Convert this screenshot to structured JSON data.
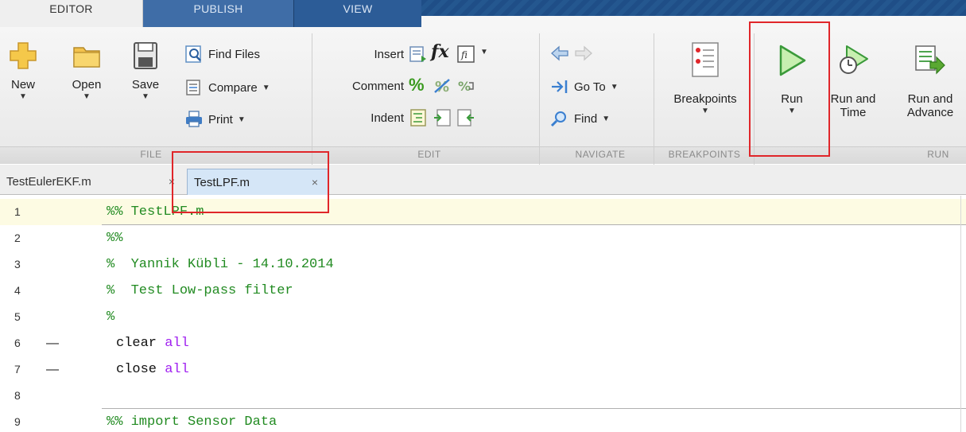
{
  "tabs": {
    "editor": "EDITOR",
    "publish": "PUBLISH",
    "view": "VIEW"
  },
  "file_group": {
    "new": "New",
    "open": "Open",
    "save": "Save",
    "find_files": "Find Files",
    "compare": "Compare",
    "print": "Print",
    "label": "FILE"
  },
  "edit_group": {
    "insert": "Insert",
    "comment": "Comment",
    "indent": "Indent",
    "fx": "fx",
    "label": "EDIT"
  },
  "navigate_group": {
    "go_to": "Go To",
    "find": "Find",
    "label": "NAVIGATE"
  },
  "breakpoints_group": {
    "breakpoints": "Breakpoints",
    "label": "BREAKPOINTS"
  },
  "run_group": {
    "run": "Run",
    "run_and_time_1": "Run and",
    "run_and_time_2": "Time",
    "run_and_advance_1": "Run and",
    "run_and_advance_2": "Advance",
    "label": "RUN"
  },
  "doc_tabs": {
    "tab1": "TestEulerEKF.m",
    "tab2": "TestLPF.m",
    "close": "×"
  },
  "editor": {
    "lines": [
      {
        "num": "1",
        "dash": "",
        "code": "%% TestLPF.m"
      },
      {
        "num": "2",
        "dash": "",
        "code": "%%"
      },
      {
        "num": "3",
        "dash": "",
        "code": "%  Yannik Kübli - 14.10.2014"
      },
      {
        "num": "4",
        "dash": "",
        "code": "%  Test Low-pass filter"
      },
      {
        "num": "5",
        "dash": "",
        "code": "%"
      },
      {
        "num": "6",
        "dash": "—",
        "code_a": "clear ",
        "code_b": "all"
      },
      {
        "num": "7",
        "dash": "—",
        "code_a": "close ",
        "code_b": "all"
      },
      {
        "num": "8",
        "dash": "",
        "code": ""
      },
      {
        "num": "9",
        "dash": "",
        "code": "%% import Sensor Data"
      }
    ]
  },
  "colors": {
    "comment": "#228b22",
    "keyword": "#a020f0",
    "annotation": "#e0262a"
  }
}
